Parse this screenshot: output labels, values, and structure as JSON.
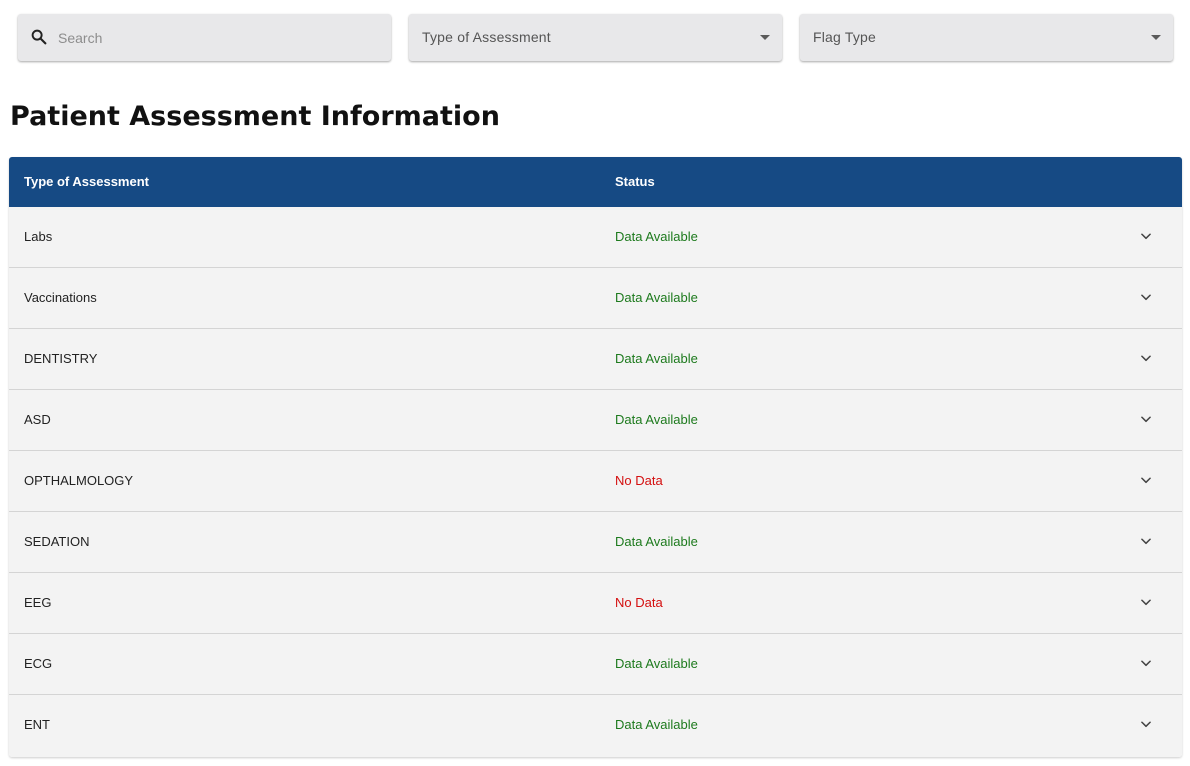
{
  "filters": {
    "search_placeholder": "Search",
    "type_select_label": "Type of Assessment",
    "flag_select_label": "Flag Type"
  },
  "page": {
    "title": "Patient Assessment Information"
  },
  "table": {
    "headers": {
      "type": "Type of Assessment",
      "status": "Status"
    },
    "rows": [
      {
        "type": "Labs",
        "status": "Data Available",
        "state": "available"
      },
      {
        "type": "Vaccinations",
        "status": "Data Available",
        "state": "available"
      },
      {
        "type": "DENTISTRY",
        "status": "Data Available",
        "state": "available"
      },
      {
        "type": "ASD",
        "status": "Data Available",
        "state": "available"
      },
      {
        "type": "OPTHALMOLOGY",
        "status": "No Data",
        "state": "nodata"
      },
      {
        "type": "SEDATION",
        "status": "Data Available",
        "state": "available"
      },
      {
        "type": "EEG",
        "status": "No Data",
        "state": "nodata"
      },
      {
        "type": "ECG",
        "status": "Data Available",
        "state": "available"
      },
      {
        "type": "ENT",
        "status": "Data Available",
        "state": "available"
      }
    ]
  },
  "colors": {
    "header_bg": "#164a84",
    "available": "#1d7a1d",
    "nodata": "#d40f0f",
    "row_bg": "#f3f3f3"
  },
  "icons": {
    "search": "search-icon",
    "dropdown": "caret-down-icon",
    "expand": "chevron-down-icon"
  }
}
